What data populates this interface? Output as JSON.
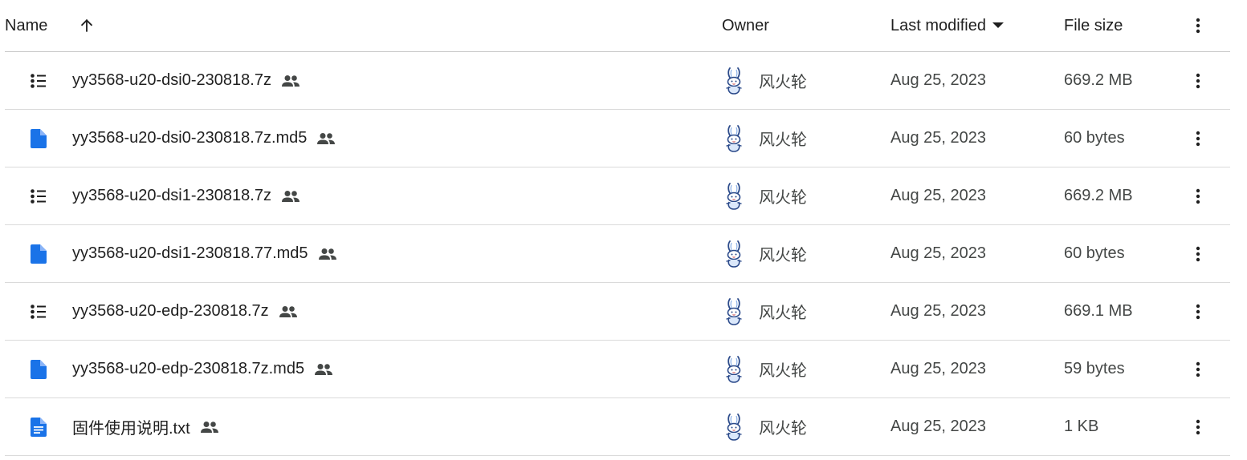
{
  "header": {
    "name_label": "Name",
    "owner_label": "Owner",
    "last_modified_label": "Last modified",
    "file_size_label": "File size"
  },
  "colors": {
    "doc_blue": "#1a73e8",
    "text_primary": "#1f1f1f",
    "text_secondary": "#444746",
    "divider": "#dadada"
  },
  "files": [
    {
      "icon": "list-file-icon",
      "name": "yy3568-u20-dsi0-230818.7z",
      "owner": "风火轮",
      "modified": "Aug 25, 2023",
      "size": "669.2 MB"
    },
    {
      "icon": "blue-doc-icon",
      "name": "yy3568-u20-dsi0-230818.7z.md5",
      "owner": "风火轮",
      "modified": "Aug 25, 2023",
      "size": "60 bytes"
    },
    {
      "icon": "list-file-icon",
      "name": "yy3568-u20-dsi1-230818.7z",
      "owner": "风火轮",
      "modified": "Aug 25, 2023",
      "size": "669.2 MB"
    },
    {
      "icon": "blue-doc-icon",
      "name": "yy3568-u20-dsi1-230818.77.md5",
      "owner": "风火轮",
      "modified": "Aug 25, 2023",
      "size": "60 bytes"
    },
    {
      "icon": "list-file-icon",
      "name": "yy3568-u20-edp-230818.7z",
      "owner": "风火轮",
      "modified": "Aug 25, 2023",
      "size": "669.1 MB"
    },
    {
      "icon": "blue-doc-icon",
      "name": "yy3568-u20-edp-230818.7z.md5",
      "owner": "风火轮",
      "modified": "Aug 25, 2023",
      "size": "59 bytes"
    },
    {
      "icon": "text-doc-icon",
      "name": "固件使用说明.txt",
      "owner": "风火轮",
      "modified": "Aug 25, 2023",
      "size": "1 KB"
    }
  ]
}
